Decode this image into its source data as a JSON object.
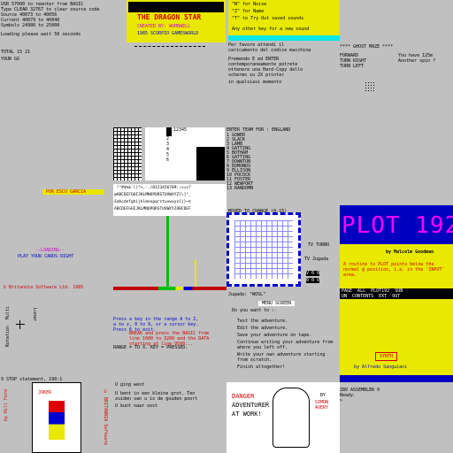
{
  "top_left": {
    "lines": [
      "USR 57000 to reenter from BASIC",
      "Type CLEAR 32767 to clear source code",
      "Source 40073 to 40056",
      "Current 40079 to 40040",
      "Symbols 24980 to 25000",
      "Loading please wait 50 seconds"
    ],
    "total_line": "TOTAL 15 21",
    "your_go": "YOUR GO"
  },
  "game_logo": {
    "title": "THE DRAGON STAR",
    "credit": "CREATED BY: WOMBWELL",
    "publisher": "1985 SCORPIO GAMESWORLD"
  },
  "save_menu": {
    "lines": [
      "\"N\" for Noise",
      "\"Z\" for Name",
      "\"T\" to Try Out saved sounds",
      "Any other key for a new sound"
    ]
  },
  "ghost_text": {
    "lines": [
      "Per favore attendi il",
      "caricamento del codice macchina",
      "Premendo E ed ENTER",
      "contemporaneamente potrete",
      "ottenere una Hard-Copy dello",
      "schermo su 2X printer",
      "in qualsiasi momento"
    ],
    "mode": "**** GHOST MAZE ****",
    "keys": [
      "FORWARD",
      "TURN RIGHT",
      "TURN LEFT"
    ],
    "question": "You have 125m\nAnother spin ?"
  },
  "team_select": {
    "title": "ENTER TEAM FOR : ENGLAND",
    "players": [
      "1 GOWER",
      "2 SLACK",
      "3 LAMB",
      "4 GATTING",
      "5 BOTHAM",
      "6 GATTING",
      "7 DOWNTON",
      "8 EDMONDS",
      "9 ELLISON",
      "10 POCOCK",
      "11 FOSTER",
      "12 NEWPORT",
      "13 RANDOMN"
    ]
  },
  "char_set": {
    "row1": " !\"#$%&'()*+,-./0123456789:;<=>?",
    "row2": "@ABCDEFGHIJKLMNOPQRSTUVWXYZ[\\]^_",
    "row3": "£abcdefghijklmnopqrstuvwxyz{|}~©",
    "row4": "ABCDEFGHIJKLMNOPQRSTUVWXYZABCDEF"
  },
  "misc_left": {
    "por": "POR ESCO GARCIA",
    "loading": "--LOADING--",
    "play": "PLAY YOUR CARDS RIGHT",
    "britannia": "© Britannia Software Ltd. 1985"
  },
  "fill_panel": {
    "prompt": "MOVED TO CHANGE (0-15)",
    "labels": [
      "TV TURNO",
      "TV Jugada"
    ],
    "counters": [
      "V 0 0",
      "0 0 V"
    ]
  },
  "plot_panel": {
    "title": "PLOT 192",
    "author": "by Malcolm Goodman",
    "desc": "A routine to PLOT points below the normal @ position, i.e. in the 'INPUT' area.",
    "menu1": "PAGE  ALL  PLOT192  SUB",
    "menu2": "UN  CONTENTS  EXT  OUT",
    "synth": "SYNTH",
    "credit": "by Alfredo Sanguiani"
  },
  "adventure_menu": {
    "header": "Jugada: \"WOSL\"",
    "menu_title": "MENU SCREEN",
    "question": "Do you want to :-",
    "options": [
      "Test the adventure.",
      "Edit the adventure.",
      "Save your adventure on tape.",
      "Continue writing your adventure from where you left off.",
      "Write your own adventure starting from scratch.",
      "Finish altogether!"
    ]
  },
  "rotation_panel": {
    "labels": [
      "Multi",
      "Rotation",
      "Lunar"
    ]
  },
  "break_text": {
    "line1": "Press a key in the range A to Z,",
    "line2": "a to z, 0 to 9, or a cursor key.",
    "line3": "Press 6 to exit.",
    "line4": "BREAK and press the BASIC from",
    "line5": "line 1000 to 3200 and the DATA",
    "line6": "starting at line 9500...",
    "range": "RANGE = TO X. KEY = PRESSED."
  },
  "stop_statement": "9 STOP statement, 190:1",
  "dutch": {
    "line0": "U ging west",
    "lines": [
      "U bent in een kleine grot. Ten",
      "zuiden van u is de gouden poort",
      "U kunt naar oost"
    ]
  },
  "danger": {
    "title": "DANGER",
    "sub": "ADVENTURER",
    "sub2": "AT WORK!",
    "by": "BY",
    "author": "SIMON AVERY"
  },
  "z80": {
    "title": "Z80 ASSEMBLER 0",
    "ready": "Ready.",
    "prompt": ">"
  },
  "card": {
    "side_left": "by Hill Ford",
    "side_right": "© BRITANNIA Software",
    "joker": "JOKER"
  }
}
